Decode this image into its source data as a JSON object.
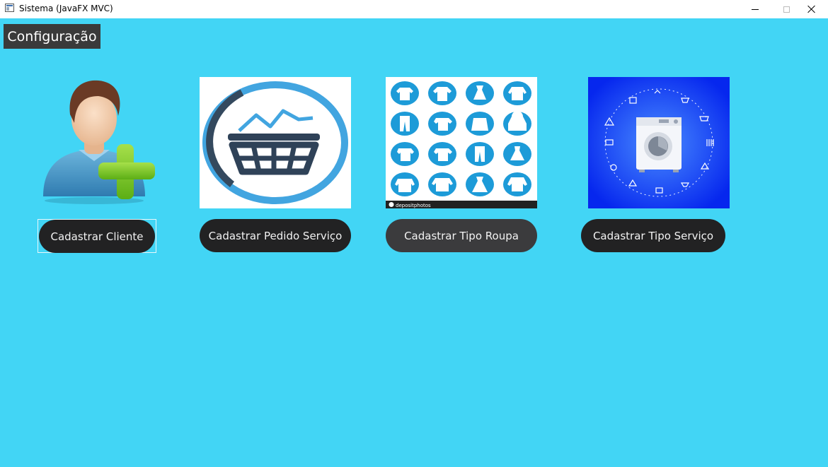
{
  "window": {
    "title": "Sistema (JavaFX MVC)",
    "controls": {
      "minimize": "minimize-icon",
      "maximize": "maximize-icon",
      "close": "close-icon"
    }
  },
  "menu": {
    "configuracao": "Configuração"
  },
  "tiles": [
    {
      "icon": "add-user-icon",
      "button": "Cadastrar Cliente"
    },
    {
      "icon": "laundry-basket-icon",
      "button": "Cadastrar Pedido Serviço"
    },
    {
      "icon": "clothing-types-icon",
      "button": "Cadastrar Tipo Roupa",
      "footer_brand": "depositphotos"
    },
    {
      "icon": "washing-machine-icon",
      "button": "Cadastrar Tipo Serviço"
    }
  ],
  "colors": {
    "background": "#42d5f5",
    "button": "#222223",
    "button_hover": "#3b3b3d",
    "menu": "#3a3a3a",
    "accent_green": "#7dcc1e",
    "basket_blue": "#3fa3df",
    "machine_bg": "#0a2ef0"
  }
}
